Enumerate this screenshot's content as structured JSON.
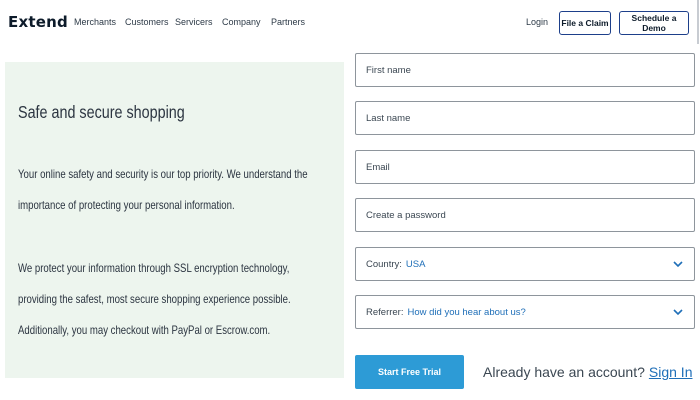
{
  "header": {
    "logo": "Extend",
    "nav": [
      "Merchants",
      "Customers",
      "Servicers",
      "Company",
      "Partners"
    ],
    "login": "Login",
    "file_claim": "File a Claim",
    "schedule_demo": "Schedule a Demo"
  },
  "info": {
    "title": "Safe and secure shopping",
    "para1": "Your online safety and security is our top priority. We understand the importance of protecting your personal information.",
    "para2": "We protect your information through SSL encryption technology, providing the safest, most secure shopping experience possible. Additionally, you may checkout with PayPal or Escrow.com."
  },
  "form": {
    "first_name": "First name",
    "last_name": "Last name",
    "email": "Email",
    "password": "Create a password",
    "country_label": "Country:",
    "country_value": "USA",
    "referrer_label": "Referrer:",
    "referrer_value": "How did you hear about us?",
    "submit": "Start Free Trial",
    "account_prompt": "Already have an account?",
    "sign_in": "Sign In"
  },
  "colors": {
    "panel_bg": "#edf5ee",
    "primary_button": "#2d9bd6",
    "link": "#1f6fb8",
    "outline_button_border": "#1d3f8a"
  },
  "icons": [
    "chevron-down-icon"
  ]
}
